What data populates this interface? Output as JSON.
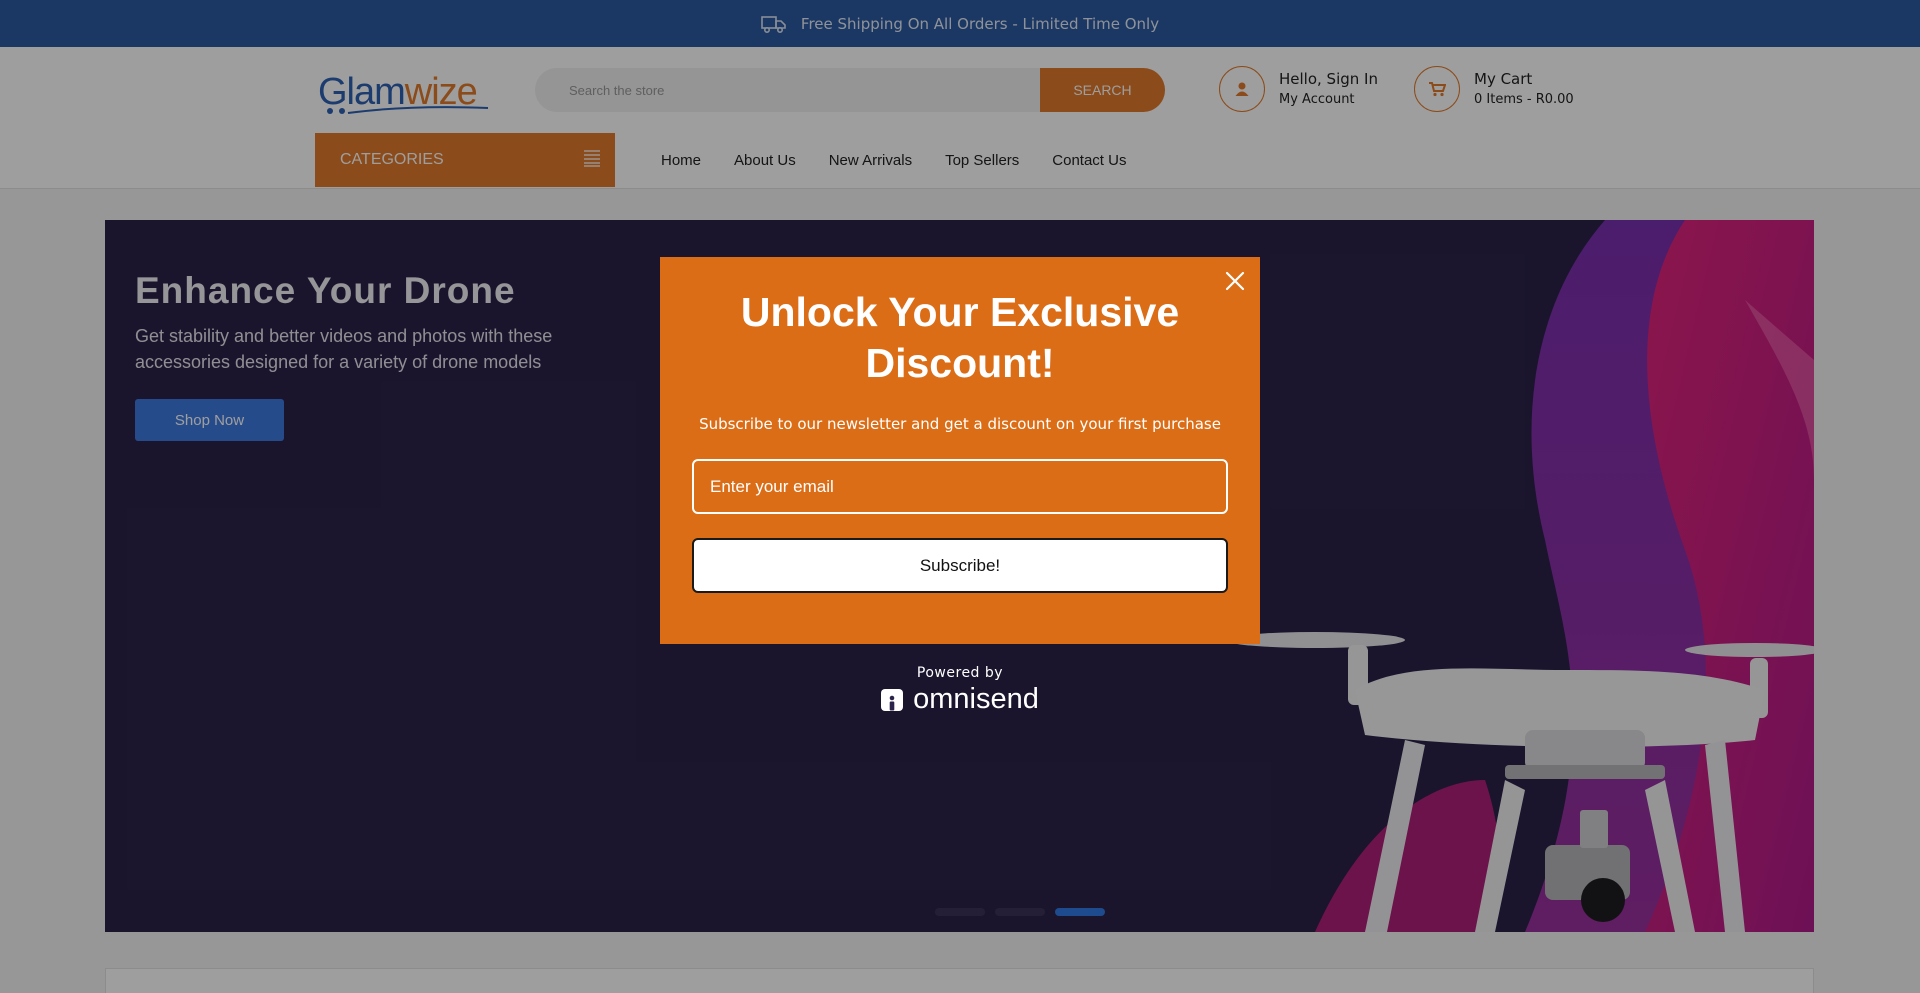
{
  "topbar": {
    "text": "Free Shipping On All Orders - Limited Time Only",
    "icon": "truck-icon"
  },
  "header": {
    "logo": {
      "part1": "Glam",
      "part2": "wize"
    },
    "search": {
      "placeholder": "Search the store",
      "button": "SEARCH"
    },
    "account": {
      "greeting": "Hello, Sign In",
      "label": "My Account",
      "icon": "user-icon"
    },
    "cart": {
      "title": "My Cart",
      "summary": "0 Items - R0.00",
      "icon": "cart-icon"
    }
  },
  "categories": {
    "label": "CATEGORIES",
    "icon": "menu-lines-icon"
  },
  "nav": [
    "Home",
    "About Us",
    "New Arrivals",
    "Top Sellers",
    "Contact Us"
  ],
  "hero": {
    "title": "Enhance Your Drone",
    "text": "Get stability and better videos and photos with these accessories designed for a variety of drone models",
    "button": "Shop Now"
  },
  "slider": {
    "slides": 3,
    "active": 3
  },
  "popup": {
    "title": "Unlock Your Exclusive Discount!",
    "subtitle": "Subscribe to our newsletter and get a discount on your first purchase",
    "email_placeholder": "Enter your email",
    "button": "Subscribe!",
    "powered_by": "Powered by",
    "brand": "omnisend"
  },
  "colors": {
    "accent": "#e07a2a",
    "primary": "#2c5aa0",
    "popup": "#db6d17",
    "hero_bg": "#2b2349"
  }
}
